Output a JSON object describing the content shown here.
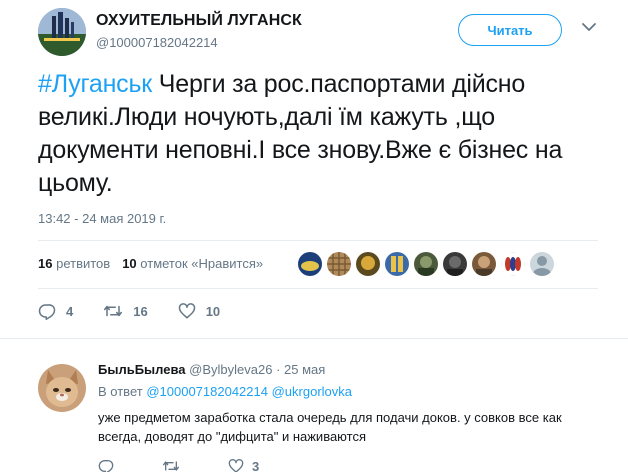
{
  "tweet": {
    "author_name": "ОХУИТЕЛЬНЫЙ ЛУГАНСК",
    "author_handle": "@100007182042214",
    "follow_label": "Читать",
    "hashtag": "#Луганськ",
    "text": " Черги за рос.паспортами дійсно великі.Люди ночують,далі їм кажуть ,що документи неповні.І все знову.Вже є бізнес на цьому.",
    "timestamp": "13:42 - 24 мая 2019 г.",
    "retweets_count": "16",
    "retweets_label": "ретвитов",
    "likes_count": "10",
    "likes_label": "отметок «Нравится»",
    "actions": {
      "replies": "4",
      "retweets": "16",
      "likes": "10"
    }
  },
  "reply": {
    "author_name": "БыльБылева",
    "author_handle": "@Bylbyleva26",
    "separator": "·",
    "date": "25 мая",
    "reply_prefix": "В ответ",
    "reply_to_1": "@100007182042214",
    "reply_to_2": "@ukrgorlovka",
    "text": "уже предметом заработка стала очередь для подачи доков. у совков все как всегда, доводят  до \"дифцита\" и наживаются",
    "actions": {
      "replies": "",
      "retweets": "",
      "likes": "3"
    }
  },
  "colors": {
    "accent": "#1da1f2",
    "muted": "#657786",
    "text": "#14171a",
    "divider": "#e6ecf0"
  },
  "icons": [
    "reply-icon",
    "retweet-icon",
    "like-icon",
    "caret-down-icon"
  ]
}
